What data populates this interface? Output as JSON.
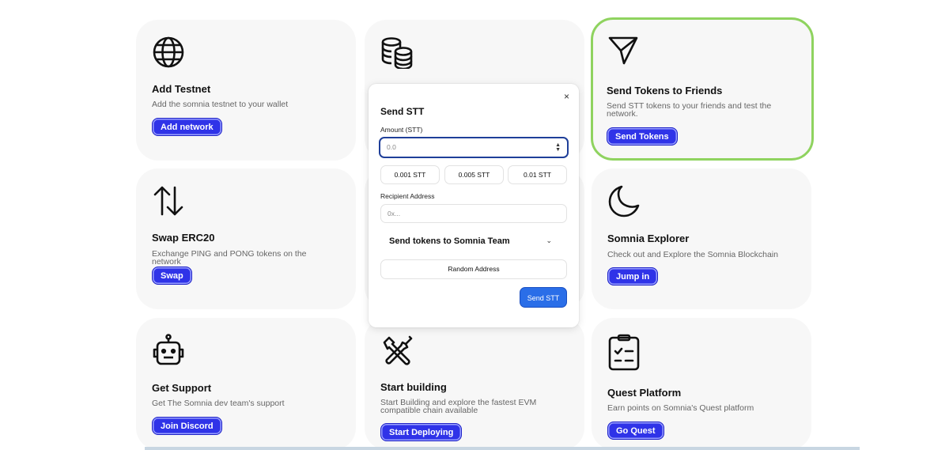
{
  "cards": {
    "add_testnet": {
      "title": "Add Testnet",
      "desc": "Add the somnia testnet to your wallet",
      "button": "Add network"
    },
    "send_tokens": {
      "title": "Send Tokens to Friends",
      "desc": "Send STT tokens to your friends and test the network.",
      "button": "Send Tokens"
    },
    "swap": {
      "title": "Swap ERC20",
      "desc": "Exchange PING and PONG tokens on the network",
      "button": "Swap"
    },
    "explorer": {
      "title": "Somnia Explorer",
      "desc": "Check out and Explore the Somnia Blockchain",
      "button": "Jump in"
    },
    "support": {
      "title": "Get Support",
      "desc": "Get The Somnia dev team's support",
      "button": "Join Discord"
    },
    "building": {
      "title": "Start building",
      "desc": "Start Building and explore the fastest EVM compatible chain available",
      "button": "Start Deploying"
    },
    "quest": {
      "title": "Quest Platform",
      "desc": "Earn points on Somnia's Quest platform",
      "button": "Go Quest"
    }
  },
  "modal": {
    "title": "Send STT",
    "close": "×",
    "amount_label": "Amount (STT)",
    "amount_placeholder": "0.0",
    "presets": [
      "0.001 STT",
      "0.005 STT",
      "0.01 STT"
    ],
    "recipient_label": "Recipient Address",
    "recipient_placeholder": "0x...",
    "accordion_title": "Send tokens to Somnia Team",
    "random_address": "Random Address",
    "send_button": "Send STT"
  },
  "colors": {
    "accent": "#2f33e8",
    "highlight_border": "#8fd35f",
    "send_button": "#2a6ee8"
  }
}
